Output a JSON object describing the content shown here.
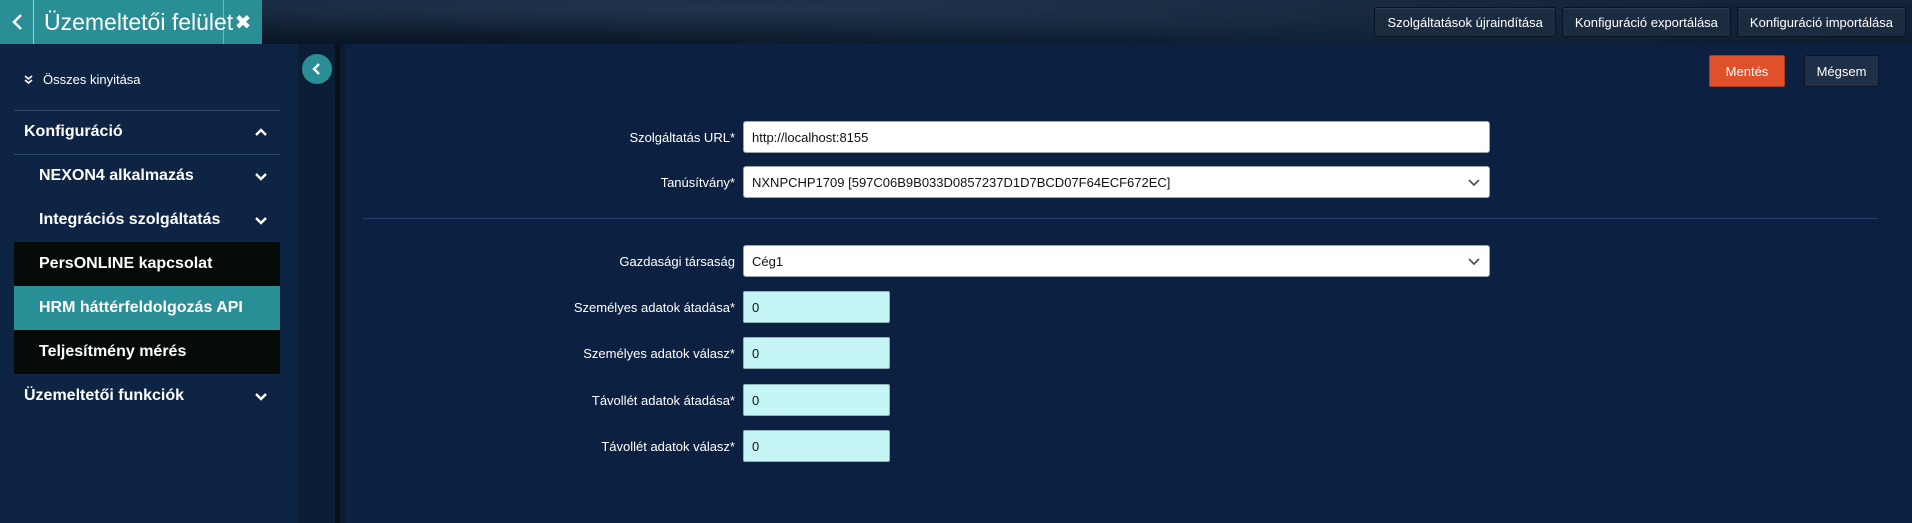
{
  "header": {
    "title": "Üzemeltetői felület",
    "actions": [
      {
        "label": "Szolgáltatások újraindítása"
      },
      {
        "label": "Konfiguráció exportálása"
      },
      {
        "label": "Konfiguráció importálása"
      }
    ]
  },
  "sidebar": {
    "expand_all": "Összes kinyitása",
    "items": [
      {
        "label": "Konfiguráció",
        "state": "expanded"
      },
      {
        "label": "NEXON4 alkalmazás",
        "state": "collapsed"
      },
      {
        "label": "Integrációs szolgáltatás",
        "state": "collapsed"
      },
      {
        "label": "PersONLINE kapcsolat"
      },
      {
        "label": "HRM háttérfeldolgozás API",
        "active": true
      },
      {
        "label": "Teljesítmény mérés"
      },
      {
        "label": "Üzemeltetői funkciók",
        "state": "collapsed"
      }
    ]
  },
  "toolbar": {
    "save_label": "Mentés",
    "cancel_label": "Mégsem"
  },
  "form": {
    "service_url": {
      "label": "Szolgáltatás URL*",
      "value": "http://localhost:8155"
    },
    "certificate": {
      "label": "Tanúsítvány*",
      "value": "NXNPCHP1709 [597C06B9B033D0857237D1D7BCD07F64ECF672EC]"
    },
    "company": {
      "label": "Gazdasági társaság",
      "value": "Cég1"
    },
    "personal_transfer": {
      "label": "Személyes adatok átadása*",
      "value": "0"
    },
    "personal_response": {
      "label": "Személyes adatok válasz*",
      "value": "0"
    },
    "absence_transfer": {
      "label": "Távollét adatok átadása*",
      "value": "0"
    },
    "absence_response": {
      "label": "Távollét adatok válasz*",
      "value": "0"
    }
  },
  "colors": {
    "accent": "#2a8e96",
    "save": "#e0502a",
    "panel": "#0c2142",
    "sidebar": "#0e2444",
    "numeric_field": "#c6f5f5"
  }
}
